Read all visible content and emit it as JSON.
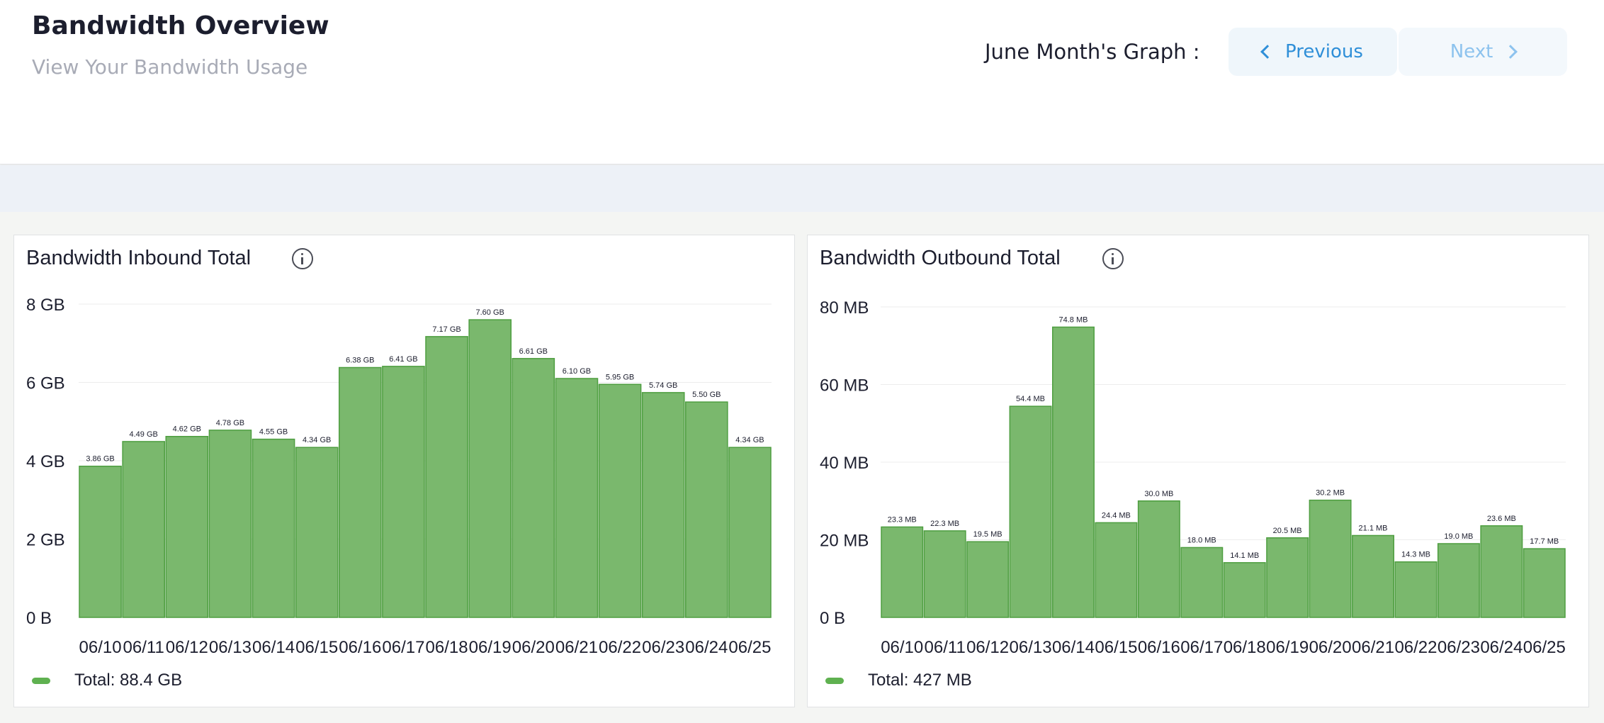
{
  "header": {
    "title": "Bandwidth Overview",
    "subtitle": "View Your Bandwidth Usage",
    "month_label": "June Month's Graph :",
    "prev_label": "Previous",
    "next_label": "Next"
  },
  "colors": {
    "bar": "#7ab86d",
    "bar_border": "#4e9e40",
    "accent": "#2f8fd8"
  },
  "inbound": {
    "title": "Bandwidth Inbound Total",
    "legend": "Total: 88.4 GB"
  },
  "outbound": {
    "title": "Bandwidth Outbound Total",
    "legend": "Total: 427 MB"
  },
  "chart_data": [
    {
      "type": "bar",
      "title": "Bandwidth Inbound Total",
      "categories": [
        "06/10",
        "06/11",
        "06/12",
        "06/13",
        "06/14",
        "06/15",
        "06/16",
        "06/17",
        "06/18",
        "06/19",
        "06/20",
        "06/21",
        "06/22",
        "06/23",
        "06/24",
        "06/25"
      ],
      "values": [
        3.86,
        4.49,
        4.62,
        4.78,
        4.55,
        4.34,
        6.38,
        6.41,
        7.17,
        7.6,
        6.61,
        6.1,
        5.95,
        5.74,
        5.5,
        4.34
      ],
      "data_labels": [
        "3.86 GB",
        "4.49 GB",
        "4.62 GB",
        "4.78 GB",
        "4.55 GB",
        "4.34 GB",
        "6.38 GB",
        "6.41 GB",
        "7.17 GB",
        "7.60 GB",
        "6.61 GB",
        "6.10 GB",
        "5.95 GB",
        "5.74 GB",
        "5.50 GB",
        "4.34 GB"
      ],
      "unit": "GB",
      "yticks": [
        "0 B",
        "2 GB",
        "4 GB",
        "6 GB",
        "8 GB"
      ],
      "ylim": [
        0,
        8
      ],
      "grid": true,
      "legend": "Total: 88.4 GB"
    },
    {
      "type": "bar",
      "title": "Bandwidth Outbound Total",
      "categories": [
        "06/10",
        "06/11",
        "06/12",
        "06/13",
        "06/14",
        "06/15",
        "06/16",
        "06/17",
        "06/18",
        "06/19",
        "06/20",
        "06/21",
        "06/22",
        "06/23",
        "06/24",
        "06/25"
      ],
      "values": [
        23.3,
        22.3,
        19.5,
        54.4,
        74.8,
        24.4,
        30.0,
        18.0,
        14.1,
        20.5,
        30.2,
        21.1,
        14.3,
        19.0,
        23.6,
        17.7
      ],
      "data_labels": [
        "23.3 MB",
        "22.3 MB",
        "19.5 MB",
        "54.4 MB",
        "74.8 MB",
        "24.4 MB",
        "30.0 MB",
        "18.0 MB",
        "14.1 MB",
        "20.5 MB",
        "30.2 MB",
        "21.1 MB",
        "14.3 MB",
        "19.0 MB",
        "23.6 MB",
        "17.7 MB"
      ],
      "unit": "MB",
      "yticks": [
        "0 B",
        "20 MB",
        "40 MB",
        "60 MB",
        "80 MB"
      ],
      "ylim": [
        0,
        80
      ],
      "grid": true,
      "legend": "Total: 427 MB"
    }
  ]
}
